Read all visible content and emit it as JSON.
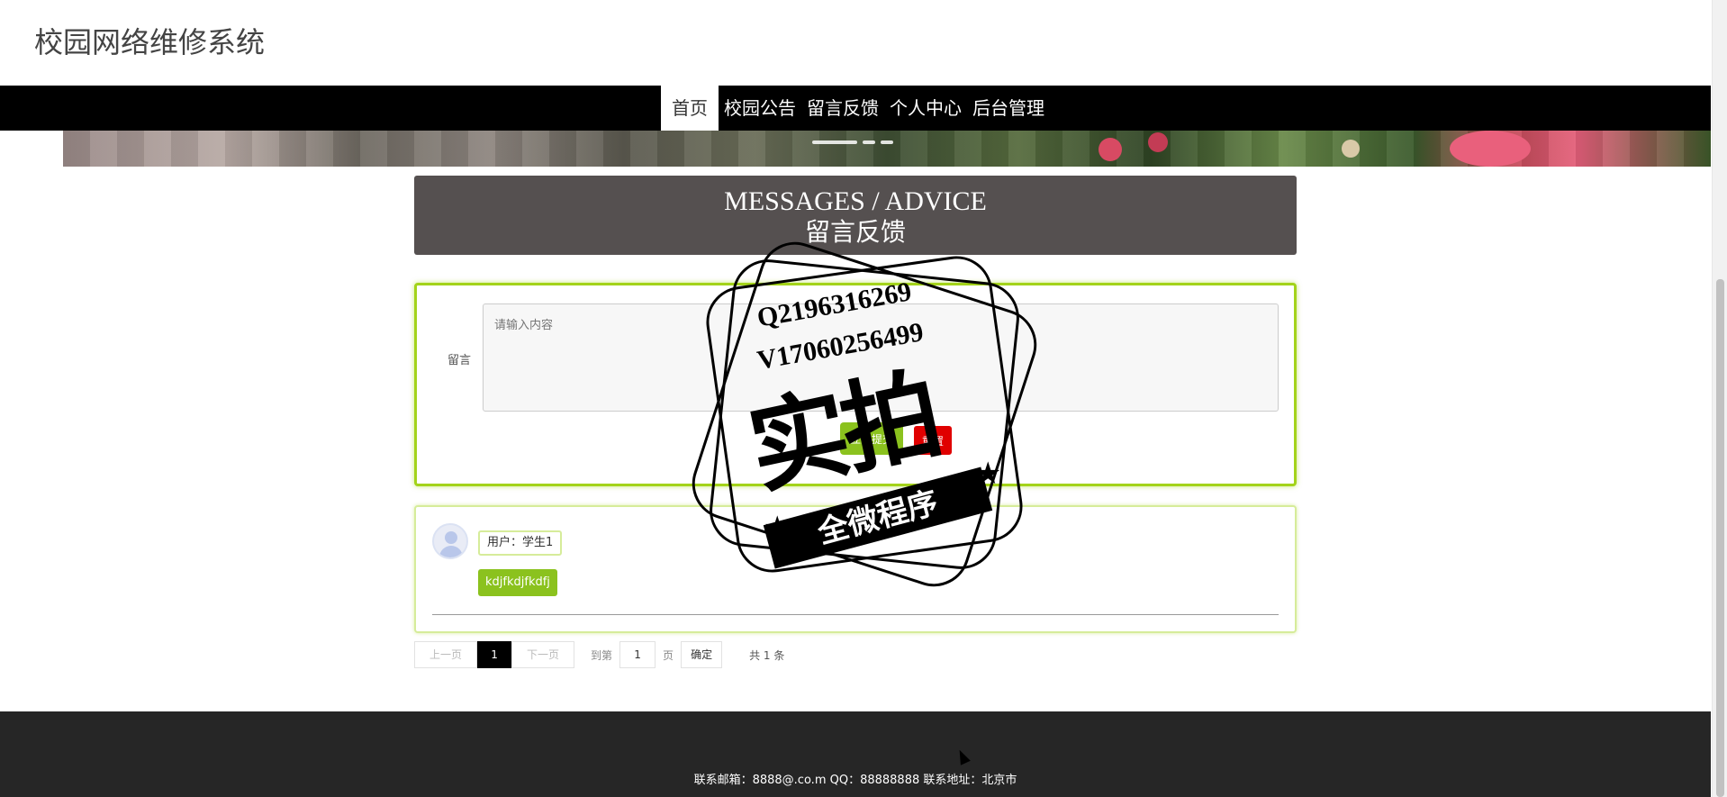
{
  "header": {
    "title": "校园网络维修系统"
  },
  "nav": {
    "items": [
      {
        "label": "首页",
        "active": true
      },
      {
        "label": "校园公告",
        "active": false
      },
      {
        "label": "留言反馈",
        "active": false
      },
      {
        "label": "个人中心",
        "active": false
      },
      {
        "label": "后台管理",
        "active": false
      }
    ]
  },
  "section": {
    "title_en": "MESSAGES / ADVICE",
    "title_cn": "留言反馈"
  },
  "form": {
    "label": "留言",
    "placeholder": "请输入内容",
    "submit_label": "立即提交",
    "reset_label": "重置"
  },
  "messages": [
    {
      "user": "用户：学生1",
      "content": "kdjfkdjfkdfj"
    }
  ],
  "pager": {
    "prev": "上一页",
    "current": "1",
    "next": "下一页",
    "goto_label": "到第",
    "goto_value": "1",
    "page_unit": "页",
    "confirm": "确定",
    "total": "共 1 条"
  },
  "footer": {
    "text": "联系邮箱：8888@.co.m QQ：88888888 联系地址：北京市"
  },
  "watermark": {
    "line1": "Q2196316269",
    "line2": "V17060256499",
    "big": "实拍",
    "ribbon": "全微程序"
  },
  "colors": {
    "accent_green": "#8bc21e",
    "nav_bg": "#000000",
    "section_bg": "#555050",
    "footer_bg": "#262626",
    "reset_red": "#e00000"
  }
}
